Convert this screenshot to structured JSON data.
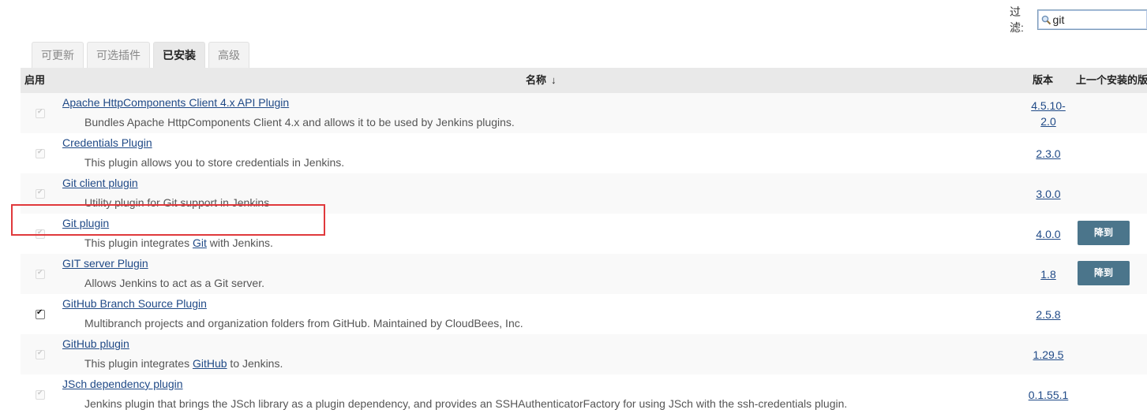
{
  "filter": {
    "label": "过滤:",
    "value": "git"
  },
  "tabs": [
    {
      "label": "可更新",
      "active": false
    },
    {
      "label": "可选插件",
      "active": false
    },
    {
      "label": "已安装",
      "active": true
    },
    {
      "label": "高级",
      "active": false
    }
  ],
  "table": {
    "headers": {
      "enabled": "启用",
      "name": "名称",
      "sort_arrow": "↓",
      "version": "版本",
      "previous": "上一个安装的版"
    },
    "rows": [
      {
        "name": "Apache HttpComponents Client 4.x API Plugin",
        "desc": "Bundles Apache HttpComponents Client 4.x and allows it to be used by Jenkins plugins.",
        "version_line1": "4.5.10-",
        "version_line2": "2.0",
        "checked": false,
        "downgrade": ""
      },
      {
        "name": "Credentials Plugin",
        "desc": "This plugin allows you to store credentials in Jenkins.",
        "version": "2.3.0",
        "checked": false,
        "downgrade": ""
      },
      {
        "name": "Git client plugin",
        "desc": "Utility plugin for Git support in Jenkins",
        "version": "3.0.0",
        "checked": false,
        "downgrade": ""
      },
      {
        "name": "Git plugin",
        "desc_pre": "This plugin integrates ",
        "desc_link": "Git",
        "desc_post": " with Jenkins.",
        "version": "4.0.0",
        "checked": false,
        "downgrade": "降到"
      },
      {
        "name": "GIT server Plugin",
        "desc": "Allows Jenkins to act as a Git server.",
        "version": "1.8",
        "checked": false,
        "downgrade": "降到"
      },
      {
        "name": "GitHub Branch Source Plugin",
        "desc": "Multibranch projects and organization folders from GitHub. Maintained by CloudBees, Inc.",
        "version": "2.5.8",
        "checked": true,
        "downgrade": ""
      },
      {
        "name": "GitHub plugin",
        "desc_pre": "This plugin integrates ",
        "desc_link": "GitHub",
        "desc_post": " to Jenkins.",
        "version": "1.29.5",
        "checked": false,
        "downgrade": ""
      },
      {
        "name": "JSch dependency plugin",
        "desc": "Jenkins plugin that brings the JSch library as a plugin dependency, and provides an SSHAuthenticatorFactory for using JSch with the ssh-credentials plugin.",
        "version": "0.1.55.1",
        "checked": false,
        "downgrade": ""
      }
    ]
  },
  "colors": {
    "highlight": "#e0393c",
    "link": "#204a87",
    "button": "#4b758b"
  }
}
